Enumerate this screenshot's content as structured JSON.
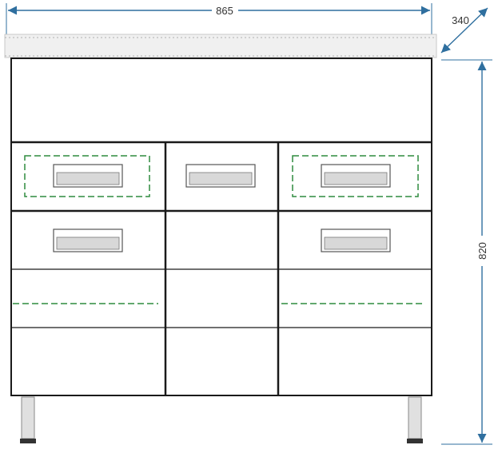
{
  "drawing": {
    "dimensions": {
      "width_label": "865",
      "depth_label": "340",
      "height_label": "820"
    },
    "colors": {
      "dimension_line": "#2f6f9f",
      "cabinet_outline": "#1a1a1a",
      "countertop_fill": "#f0f0f0",
      "handle_fill": "#d8d8d8",
      "dashed_guide": "#2e8b3e",
      "leg_fill": "#e0e0e0"
    }
  }
}
